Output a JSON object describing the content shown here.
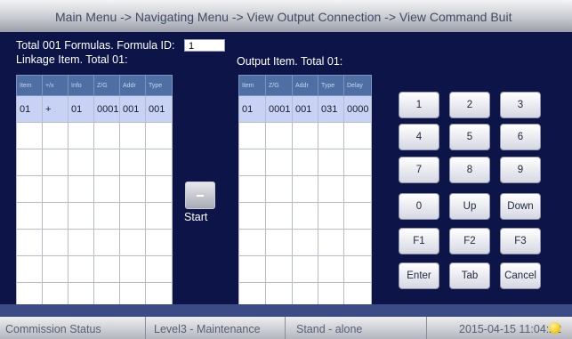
{
  "header": {
    "breadcrumb": "Main Menu -> Navigating Menu -> View Output Connection -> View Command Buit"
  },
  "main": {
    "formula_summary": "Total 001 Formulas. Formula ID:",
    "formula_id_value": "1",
    "linkage_label": "Linkage Item. Total 01:",
    "output_label": "Output Item. Total 01:",
    "linkage_table": {
      "columns": [
        "Item",
        "+/x",
        "Info",
        "Z/G",
        "Addr",
        "Type"
      ],
      "rows": [
        [
          "01",
          "+",
          "01",
          "0001",
          "001",
          "001"
        ]
      ]
    },
    "output_table": {
      "columns": [
        "Item",
        "Z/G",
        "Addr",
        "Type",
        "Delay"
      ],
      "rows": [
        [
          "01",
          "0001",
          "001",
          "031",
          "0000"
        ]
      ]
    },
    "start_label": "Start"
  },
  "keypad": {
    "keys": [
      "1",
      "2",
      "3",
      "4",
      "5",
      "6",
      "7",
      "8",
      "9",
      "0",
      "Up",
      "Down",
      "F1",
      "F2",
      "F3",
      "Enter",
      "Tab",
      "Cancel"
    ]
  },
  "status": {
    "commission": "Commission Status",
    "level": "Level3 - Maintenance",
    "mode": "Stand - alone",
    "datetime": "2015-04-15 11:04:22"
  },
  "colors": {
    "panel_bg": "#0d1548",
    "table_header": "#4d6fa4",
    "selected_row": "#c8d2f4",
    "status_indicator": "#f5c400"
  },
  "icons": {
    "status_indicator": "status-indicator-icon"
  }
}
